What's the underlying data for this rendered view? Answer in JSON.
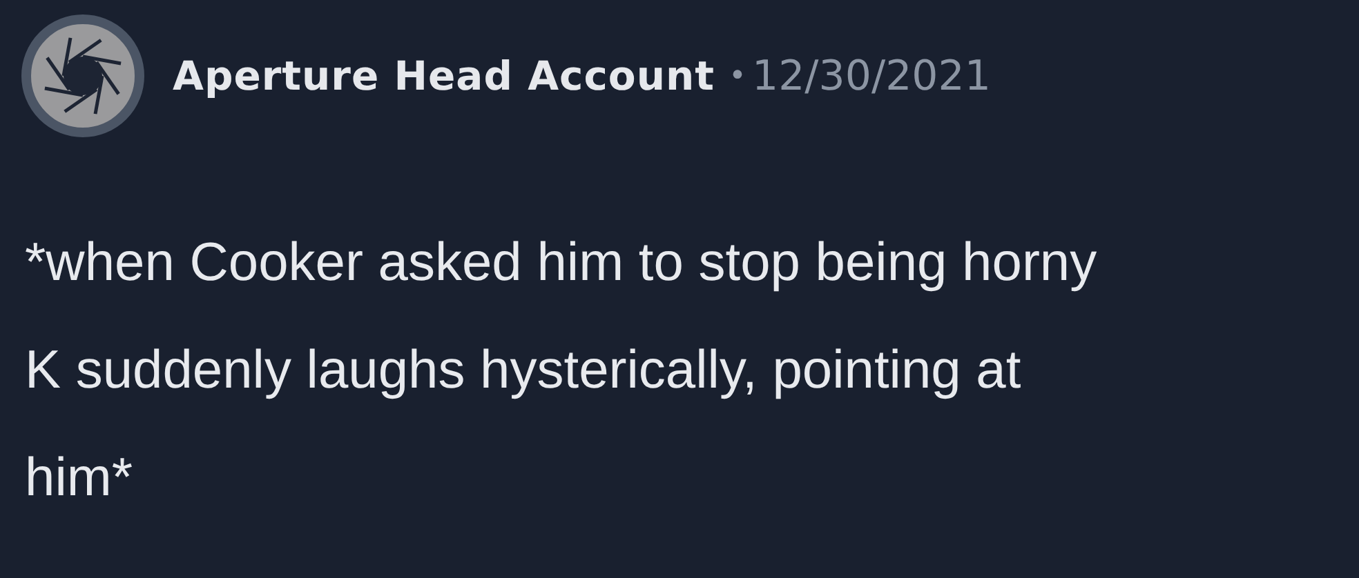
{
  "post": {
    "author": "Aperture Head Account",
    "separator": "•",
    "date": "12/30/2021",
    "body_lines": [
      "*when Cooker asked him to stop being horny",
      "K suddenly laughs hysterically, pointing at",
      "him*"
    ]
  }
}
